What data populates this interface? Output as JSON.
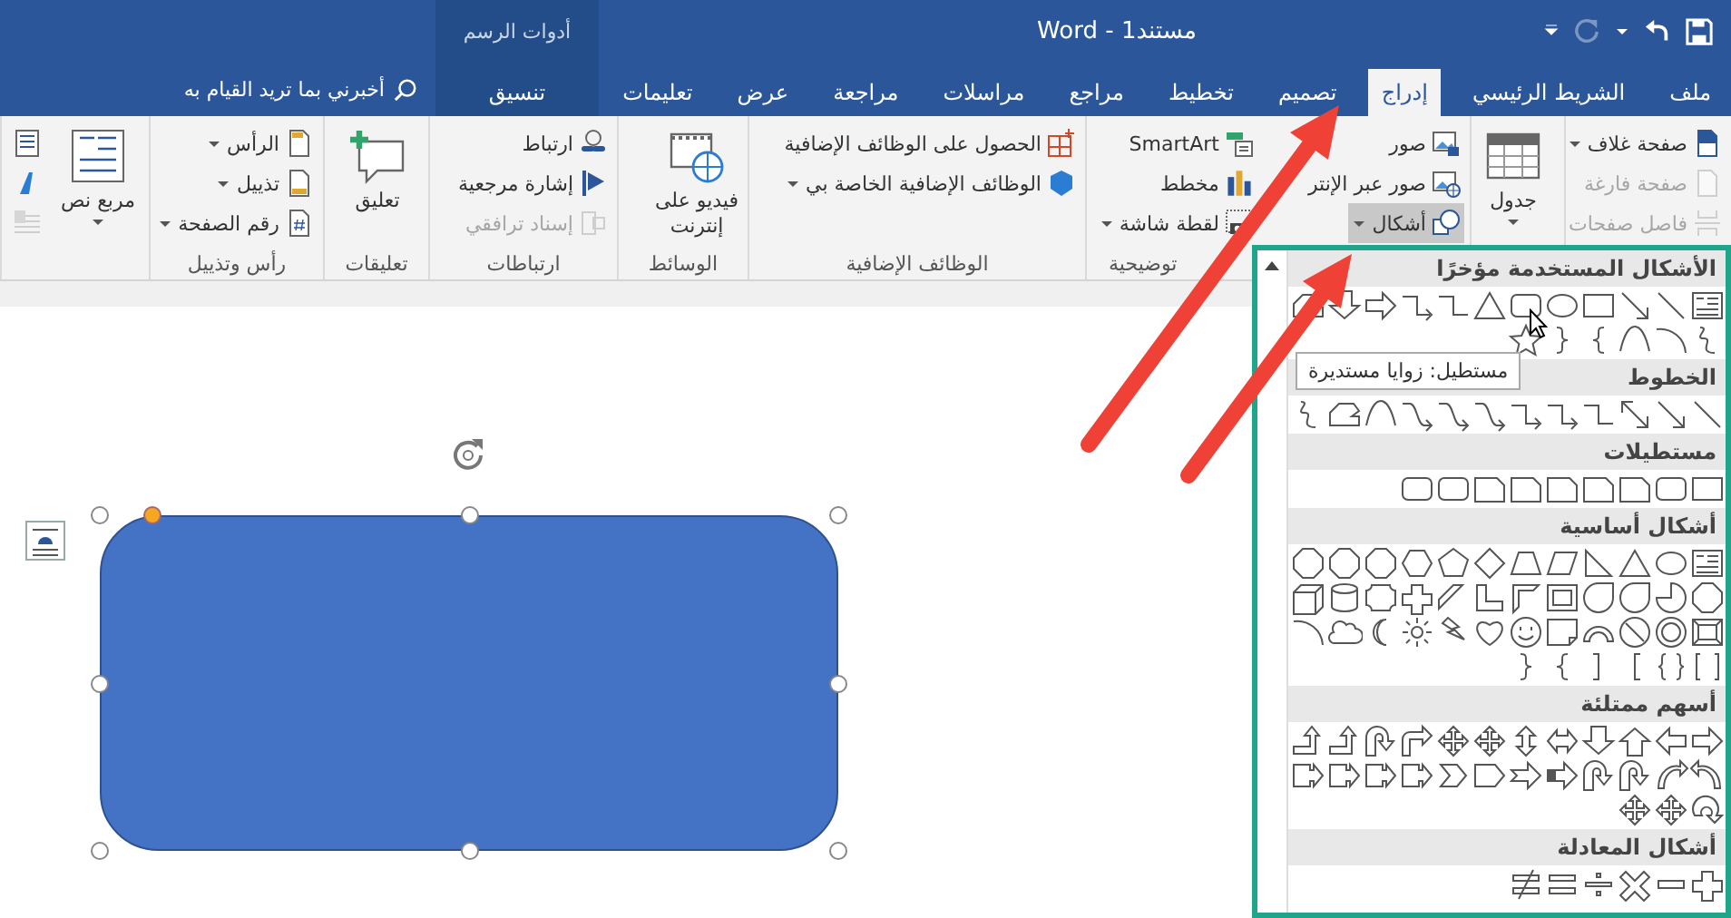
{
  "title_bar": {
    "title": "مستند1 - Word",
    "contextual_label": "أدوات الرسم",
    "redo": {
      "disabled": true
    }
  },
  "tabs": [
    {
      "label": "ملف",
      "selected": false,
      "contextual": false
    },
    {
      "label": "الشريط الرئيسي",
      "selected": false,
      "contextual": false
    },
    {
      "label": "إدراج",
      "selected": true,
      "contextual": false
    },
    {
      "label": "تصميم",
      "selected": false,
      "contextual": false
    },
    {
      "label": "تخطيط",
      "selected": false,
      "contextual": false
    },
    {
      "label": "مراجع",
      "selected": false,
      "contextual": false
    },
    {
      "label": "مراسلات",
      "selected": false,
      "contextual": false
    },
    {
      "label": "مراجعة",
      "selected": false,
      "contextual": false
    },
    {
      "label": "عرض",
      "selected": false,
      "contextual": false
    },
    {
      "label": "تعليمات",
      "selected": false,
      "contextual": false
    },
    {
      "label": "تنسيق",
      "selected": false,
      "contextual": true
    }
  ],
  "tell_me": {
    "label": "أخبرني بما تريد القيام به"
  },
  "ribbon": {
    "groups": [
      {
        "items": [
          {
            "kind": "small",
            "label": "صفحة غلاف",
            "dropdown": true,
            "disabled": false,
            "pressed": false
          },
          {
            "kind": "small",
            "label": "صفحة فارغة",
            "dropdown": false,
            "disabled": true,
            "pressed": false
          },
          {
            "kind": "small",
            "label": "فاصل صفحات",
            "dropdown": false,
            "disabled": true,
            "pressed": false
          }
        ]
      },
      {
        "items": [
          {
            "kind": "large",
            "label": "جدول",
            "dropdown": true,
            "disabled": false,
            "pressed": false
          }
        ]
      },
      {
        "label": "توضيحية",
        "items": [
          {
            "kind": "small",
            "label": "صور",
            "dropdown": false,
            "disabled": false,
            "pressed": false
          },
          {
            "kind": "small",
            "label": "صور عبر الإنتر",
            "dropdown": false,
            "disabled": false,
            "pressed": false
          },
          {
            "kind": "small",
            "label": "أشكال",
            "dropdown": true,
            "disabled": false,
            "pressed": true
          },
          {
            "kind": "small",
            "label": "SmartArt",
            "dropdown": false,
            "disabled": false,
            "pressed": false
          },
          {
            "kind": "small",
            "label": "مخطط",
            "dropdown": false,
            "disabled": false,
            "pressed": false
          },
          {
            "kind": "small",
            "label": "لقطة شاشة",
            "dropdown": true,
            "disabled": false,
            "pressed": false
          }
        ]
      },
      {
        "label": "الوظائف الإضافية",
        "items": [
          {
            "kind": "small",
            "label": "الحصول على الوظائف الإضافية",
            "dropdown": false,
            "disabled": false,
            "pressed": false
          },
          {
            "kind": "small",
            "label": "الوظائف الإضافية الخاصة بي",
            "dropdown": true,
            "disabled": false,
            "pressed": false
          }
        ]
      },
      {
        "label": "الوسائط",
        "items": [
          {
            "kind": "large",
            "label": "فيديو على إنترنت",
            "dropdown": false,
            "disabled": false,
            "pressed": false
          }
        ]
      },
      {
        "label": "ارتباطات",
        "items": [
          {
            "kind": "small",
            "label": "ارتباط",
            "dropdown": false,
            "disabled": false,
            "pressed": false
          },
          {
            "kind": "small",
            "label": "إشارة مرجعية",
            "dropdown": false,
            "disabled": false,
            "pressed": false
          },
          {
            "kind": "small",
            "label": "إسناد ترافقي",
            "dropdown": false,
            "disabled": true,
            "pressed": false
          }
        ]
      },
      {
        "label": "تعليقات",
        "items": [
          {
            "kind": "large",
            "label": "تعليق",
            "dropdown": false,
            "disabled": false,
            "pressed": false
          }
        ]
      },
      {
        "label": "رأس وتذييل",
        "items": [
          {
            "kind": "small",
            "label": "الرأس",
            "dropdown": true,
            "disabled": false,
            "pressed": false
          },
          {
            "kind": "small",
            "label": "تذييل",
            "dropdown": true,
            "disabled": false,
            "pressed": false
          },
          {
            "kind": "small",
            "label": "رقم الصفحة",
            "dropdown": true,
            "disabled": false,
            "pressed": false
          }
        ]
      },
      {
        "items": [
          {
            "kind": "large",
            "label": "مربع نص",
            "dropdown": true,
            "disabled": false,
            "pressed": false
          },
          {
            "kind": "icon",
            "dropdown": false,
            "disabled": false,
            "pressed": false
          },
          {
            "kind": "icon",
            "dropdown": false,
            "disabled": false,
            "pressed": false
          },
          {
            "kind": "icon",
            "dropdown": false,
            "disabled": true,
            "pressed": false
          }
        ]
      }
    ]
  },
  "document": {
    "shape": {
      "selected": true
    }
  },
  "shapes_panel": {
    "sections": [
      {
        "title": "الأشكال المستخدمة مؤخرًا"
      },
      {
        "title": "الخطوط"
      },
      {
        "title": "مستطيلات"
      },
      {
        "title": "أشكال أساسية"
      },
      {
        "title": "أسهم ممتلئة"
      },
      {
        "title": "أشكال المعادلة"
      }
    ],
    "tooltip": "مستطيل: زوايا مستديرة"
  }
}
